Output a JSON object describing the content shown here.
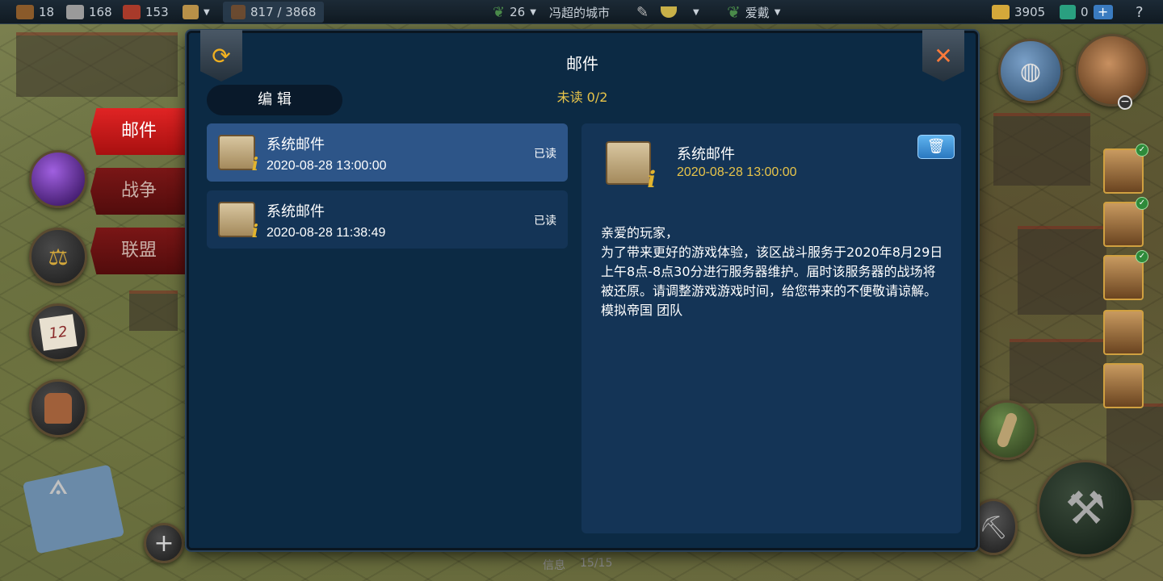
{
  "topbar": {
    "wood": "18",
    "stone": "168",
    "brick": "153",
    "population": "817 / 3868",
    "level": "26",
    "city_name": "冯超的城市",
    "player_name": "爱戴",
    "gold": "3905",
    "gems": "0",
    "plus": "+",
    "help": "?"
  },
  "side_tabs": {
    "mail": "邮件",
    "war": "战争",
    "alliance": "联盟"
  },
  "calendar_day": "12",
  "dialog": {
    "title": "邮件",
    "edit_label": "编 辑",
    "unread": "未读 0/2",
    "mails": [
      {
        "subject": "系统邮件",
        "date": "2020-08-28 13:00:00",
        "status": "已读"
      },
      {
        "subject": "系统邮件",
        "date": "2020-08-28 11:38:49",
        "status": "已读"
      }
    ],
    "detail": {
      "subject": "系统邮件",
      "date": "2020-08-28 13:00:00",
      "body": [
        "亲爱的玩家，",
        "为了带来更好的游戏体验，该区战斗服务于2020年8月29日上午8点-8点30分进行服务器维护。届时该服务器的战场将被还原。请调整游戏游戏时间，给您带来的不便敬请谅解。",
        "模拟帝国 团队"
      ]
    }
  },
  "bottom": {
    "info": "信息",
    "count": "15/15"
  },
  "colors": {
    "dialog_bg": "#0c2a44",
    "item_bg": "#143456",
    "selected_bg": "#2d5588",
    "accent_yellow": "#e8c44a",
    "tab_red": "#e02424"
  }
}
